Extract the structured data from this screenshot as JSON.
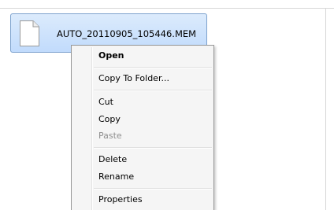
{
  "file": {
    "name": "AUTO_20110905_105446.MEM",
    "icon": "generic-file-icon"
  },
  "context_menu": {
    "open": "Open",
    "copy_to_folder": "Copy To Folder...",
    "cut": "Cut",
    "copy": "Copy",
    "paste": "Paste",
    "delete": "Delete",
    "rename": "Rename",
    "properties": "Properties"
  },
  "colors": {
    "selection_fill": "#c1dbfc",
    "selection_border": "#7da2ce",
    "menu_background": "#f5f5f5",
    "disabled_text": "#8d8d8d"
  }
}
